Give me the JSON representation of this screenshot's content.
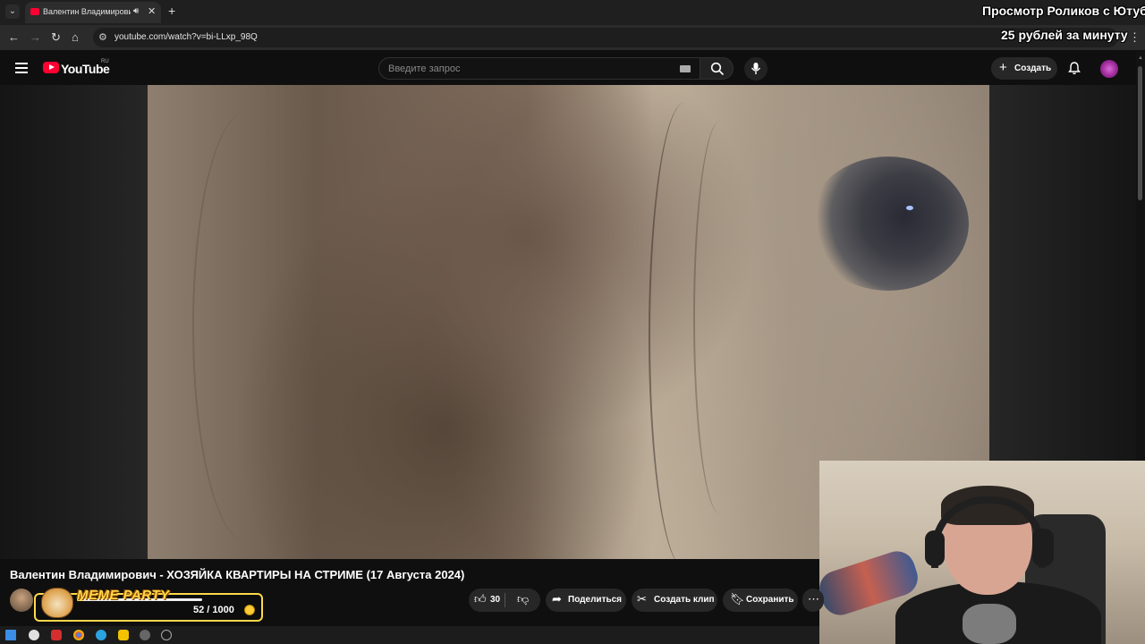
{
  "browser": {
    "tab_title": "Валентин Владимирович - ХОЗЯЙКА",
    "url": "youtube.com/watch?v=bi-LLxp_98Q"
  },
  "masthead": {
    "logo_text": "YouTube",
    "country_code": "RU",
    "search_placeholder": "Введите запрос",
    "create_label": "Создать"
  },
  "video": {
    "title": "Валентин Владимирович - ХОЗЯЙКА КВАРТИРЫ НА СТРИМЕ (17 Августа 2024)",
    "likes": "30",
    "share_label": "Поделиться",
    "clip_label": "Создать клип",
    "save_label": "Сохранить"
  },
  "overlay": {
    "promo_line1": "Просмотр Роликов с Ютуба:",
    "promo_line2": "25 рублей за минуту",
    "meme_party": {
      "label": "MEME PARTY",
      "counter": "52 / 1000",
      "progress_fraction": 0.052
    }
  },
  "colors": {
    "youtube_red": "#ff0033",
    "meme_gold": "#ffd84a"
  }
}
